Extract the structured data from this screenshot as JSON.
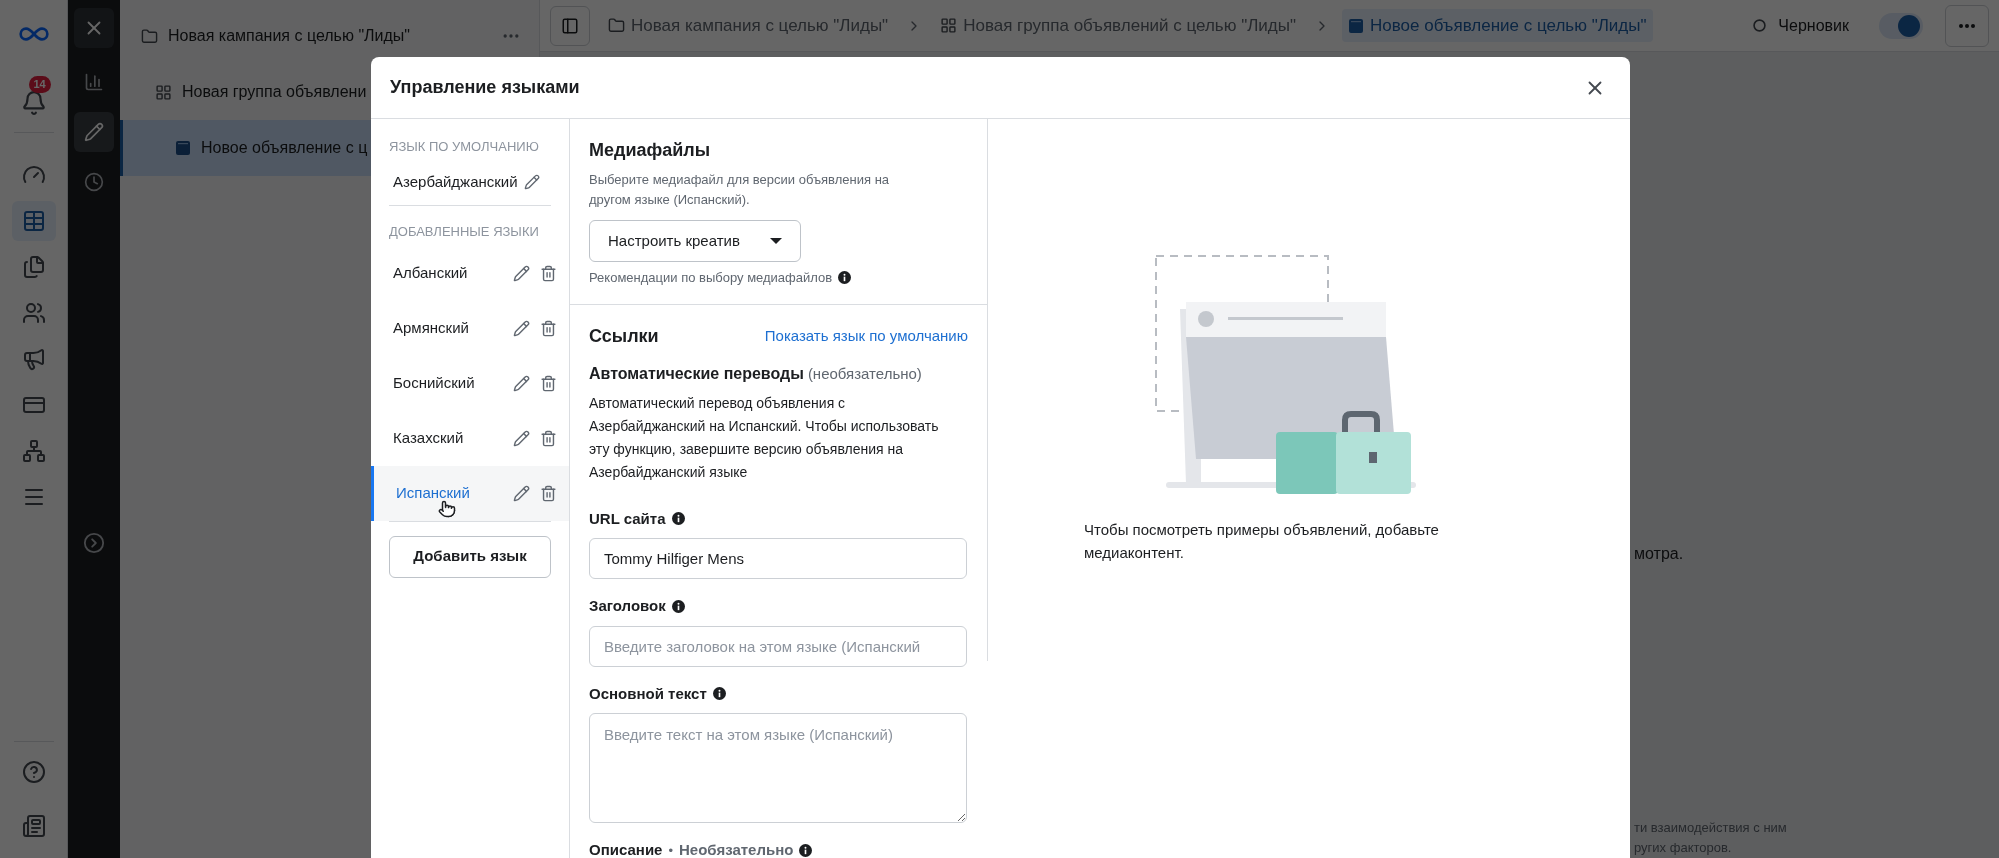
{
  "app_rail": {
    "notification_count": "14",
    "items": [
      {
        "kind": "gauge",
        "selected": false
      },
      {
        "kind": "table",
        "selected": true
      },
      {
        "kind": "documents",
        "selected": false
      },
      {
        "kind": "people",
        "selected": false
      },
      {
        "kind": "megaphone",
        "selected": false
      },
      {
        "kind": "card",
        "selected": false
      },
      {
        "kind": "network",
        "selected": false
      },
      {
        "kind": "menu",
        "selected": false
      }
    ],
    "bottom_items": [
      {
        "kind": "help"
      },
      {
        "kind": "news"
      }
    ]
  },
  "tool_rail": {
    "items": [
      {
        "kind": "chart",
        "selected": false
      },
      {
        "kind": "pencil",
        "selected": true
      },
      {
        "kind": "clock",
        "selected": false
      }
    ]
  },
  "tree": [
    {
      "kind": "campaign",
      "label": "Новая кампания с целью \"Лиды\"",
      "selected": false
    },
    {
      "kind": "adset",
      "label": "Новая группа объявлени",
      "selected": false
    },
    {
      "kind": "ad",
      "label": "Новое объявление с ц",
      "selected": true
    }
  ],
  "breadcrumbs": [
    {
      "kind": "campaign",
      "label": "Новая кампания с целью \"Лиды\"",
      "selected": false
    },
    {
      "kind": "adset",
      "label": "Новая группа объявлений с целью \"Лиды\"",
      "selected": false
    },
    {
      "kind": "ad",
      "label": "Новое объявление с целью \"Лиды\"",
      "selected": true
    }
  ],
  "status": {
    "label": "Черновик"
  },
  "toggle": {
    "on": true
  },
  "background_texts": [
    "мотра.",
    "ти взаимодействия с ним",
    "ругих факторов."
  ],
  "modal": {
    "title": "Управление языками",
    "default_language": {
      "heading": "ЯЗЫК ПО УМОЛЧАНИЮ",
      "name": "Азербайджанский"
    },
    "added_languages": {
      "heading": "ДОБАВЛЕННЫЕ ЯЗЫКИ",
      "items": [
        {
          "name": "Албанский",
          "selected": false
        },
        {
          "name": "Армянский",
          "selected": false
        },
        {
          "name": "Боснийский",
          "selected": false
        },
        {
          "name": "Казахский",
          "selected": false
        },
        {
          "name": "Испанский",
          "selected": true
        }
      ]
    },
    "add_button": "Добавить язык",
    "media": {
      "title": "Медиафайлы",
      "description": "Выберите медиафайл для версии объявления на другом языке (Испанский).",
      "dropdown": "Настроить креатив",
      "hint": "Рекомендации по выбору медиафайлов"
    },
    "links": {
      "title": "Ссылки",
      "link": "Показать язык по умолчанию",
      "auto_title": "Автоматические переводы",
      "auto_optional": "(необязательно)",
      "auto_text": "Автоматический перевод объявления с Азербайджанский на Испанский. Чтобы использовать эту функцию, завершите версию объявления на Азербайджанский языке",
      "fields": [
        {
          "kind": "input",
          "label": "URL сайта",
          "value": "Tommy Hilfiger Mens"
        },
        {
          "kind": "input",
          "label": "Заголовок",
          "placeholder": "Введите заголовок на этом языке (Испанский"
        },
        {
          "kind": "textarea",
          "label": "Основной текст",
          "placeholder": "Введите текст на этом языке (Испанский)"
        },
        {
          "kind": "heading",
          "label": "Описание",
          "separator": "•",
          "optional": "Необязательно"
        }
      ]
    },
    "preview": {
      "message": "Чтобы посмотреть примеры объявлений, добавьте медиаконтент."
    }
  }
}
